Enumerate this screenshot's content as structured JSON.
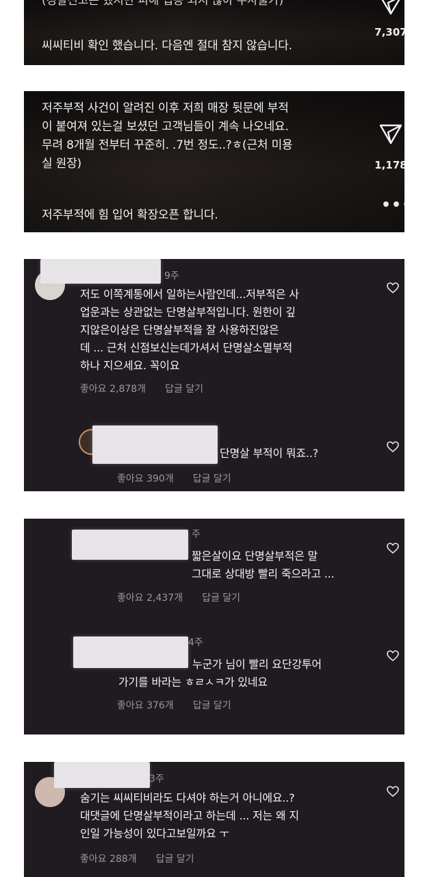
{
  "post1": {
    "top_line": "(경찰신고는 했지만 피해 입증 되지 않아 수사불가)",
    "caption": "씨씨티비 확인 했습니다. 다음엔 절대 참지 않습니다.",
    "share_count": "7,307"
  },
  "post2": {
    "caption": "저주부적 사건이 알려진 이후 저희 매장 뒷문에 부적\n이 붙여져 있는걸 보셨던 고객님들이 계속 나오네요.\n무려 8개월 전부터 꾸준히. .7번 정도..?ㅎ(근처 미용\n실 원장)",
    "caption2": "저주부적에 힘 입어 확장오픈 합니다.",
    "share_count": "1,178",
    "more_label": "•••"
  },
  "thread1": {
    "comment": {
      "time": "9주",
      "text": "저도 이쪽계통에서 일하는사람인데...저부적은 사\n업운과는 상관없는 단명살부적입니다. 원한이 깊\n지않은이상은 단명살부적을 잘 사용하진않은\n데 ... 근처 신점보신는데가셔서 단명살소멸부적\n하나 지으세요. 꼭이요",
      "likes": "좋아요 2,878개",
      "reply_label": "답글 달기"
    },
    "reply": {
      "text": "단명살 부적이 뭐죠..?",
      "likes": "좋아요 390개",
      "reply_label": "답글 달기"
    }
  },
  "thread2": {
    "reply1": {
      "time": "주",
      "text": "짧은살이요 단명살부적은 말\n그대로 상대방 빨리 죽으라고 ...",
      "likes": "좋아요 2,437개",
      "reply_label": "답글 달기"
    },
    "reply2": {
      "time": "4주",
      "text": "누군가 님이 빨리 요단강투어\n가기를 바라는 ㅎㄹㅅㅋ가 있네요",
      "likes": "좋아요 376개",
      "reply_label": "답글 달기"
    }
  },
  "thread3": {
    "comment": {
      "time": "3주",
      "text": "숨기는 씨씨티비라도 다셔야 하는거 아니에요..?\n대댓글에 단명살부적이라고 하는데 ... 저는 왜 지\n인일 가능성이 있다고보일까요 ㅜ",
      "likes": "좋아요 288개",
      "reply_label": "답글 달기"
    }
  },
  "colors": {
    "panel_bg": "#1f1b20",
    "text": "#f4f4f4",
    "muted": "#9c98a0"
  }
}
